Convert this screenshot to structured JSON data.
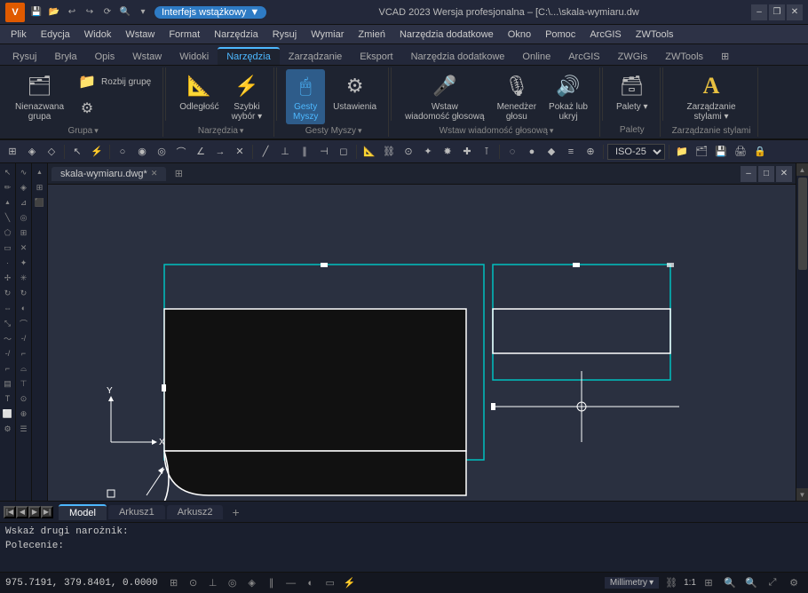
{
  "app": {
    "title": "VCAD 2023 Wersja profesjonalna – [C:\\...\\skala-wymiaru.dw",
    "logo": "V",
    "interface_name": "Interfejs wstążkowy",
    "interface_dropdown": "▼"
  },
  "title_bar": {
    "close": "✕",
    "maximize": "□",
    "minimize": "–",
    "restore": "❐"
  },
  "quick_access": [
    "💾",
    "📂",
    "↩",
    "↪",
    "⟳",
    "🔍",
    "⚙"
  ],
  "menu": {
    "items": [
      "Plik",
      "Edycja",
      "Widok",
      "Wstaw",
      "Format",
      "Narzędzia",
      "Rysuj",
      "Wymiar",
      "Zmień",
      "Narzędzia dodatkowe",
      "Okno",
      "Pomoc",
      "ArcGIS",
      "ZWTools"
    ]
  },
  "ribbon_tabs": {
    "items": [
      "Rysuj",
      "Bryła",
      "Opis",
      "Wstaw",
      "Widoki",
      "Narzędzia",
      "Zarządzanie",
      "Eksport",
      "Narzędzia dodatkowe",
      "Online",
      "ArcGIS",
      "ZWGis",
      "ZWTools",
      "⊞"
    ],
    "active": "Narzędzia"
  },
  "ribbon": {
    "groups": [
      {
        "name": "Grupa",
        "buttons": [
          {
            "icon": "🗂",
            "label": "Nienazwana\ngrupa"
          },
          {
            "icon": "📁",
            "label": "Rozbij\ngrupę"
          },
          {
            "icon": "⚙",
            "label": ""
          }
        ]
      },
      {
        "name": "Narzędzia",
        "buttons": [
          {
            "icon": "📏",
            "label": "Odległość"
          },
          {
            "icon": "⚡",
            "label": "Szybki\nwybór"
          }
        ]
      },
      {
        "name": "Gesty Myszy",
        "buttons": [
          {
            "icon": "🖱",
            "label": "Gesty\nMyszy",
            "active": true
          },
          {
            "icon": "⚙",
            "label": "Ustawienia"
          }
        ]
      },
      {
        "name": "Wstaw wiadomość głosową",
        "buttons": [
          {
            "icon": "🎤",
            "label": "Wstaw\nwiadomość głosową"
          },
          {
            "icon": "🎤",
            "label": "Menedżer\ngłosu"
          },
          {
            "icon": "🎤",
            "label": "Pokaż lub\nukryj"
          }
        ]
      },
      {
        "name": "Palety",
        "buttons": [
          {
            "icon": "🗃",
            "label": "Palety"
          }
        ]
      },
      {
        "name": "Zarządzanie stylami",
        "buttons": [
          {
            "icon": "A",
            "label": "Zarządzanie\nstylami"
          }
        ]
      }
    ]
  },
  "canvas": {
    "tab": "skala-wymiaru.dwg*",
    "modified": true
  },
  "model_tabs": {
    "items": [
      "Model",
      "Arkusz1",
      "Arkusz2"
    ],
    "active": "Model",
    "add_label": "+"
  },
  "toolbar": {
    "iso_value": "ISO-25"
  },
  "command": {
    "output": "Wskaż drugi narożnik:",
    "prompt": "Polecenie:"
  },
  "status": {
    "coords": "975.7191, 379.8401, 0.0000",
    "unit": "Millimetry",
    "scale": "1:1"
  }
}
